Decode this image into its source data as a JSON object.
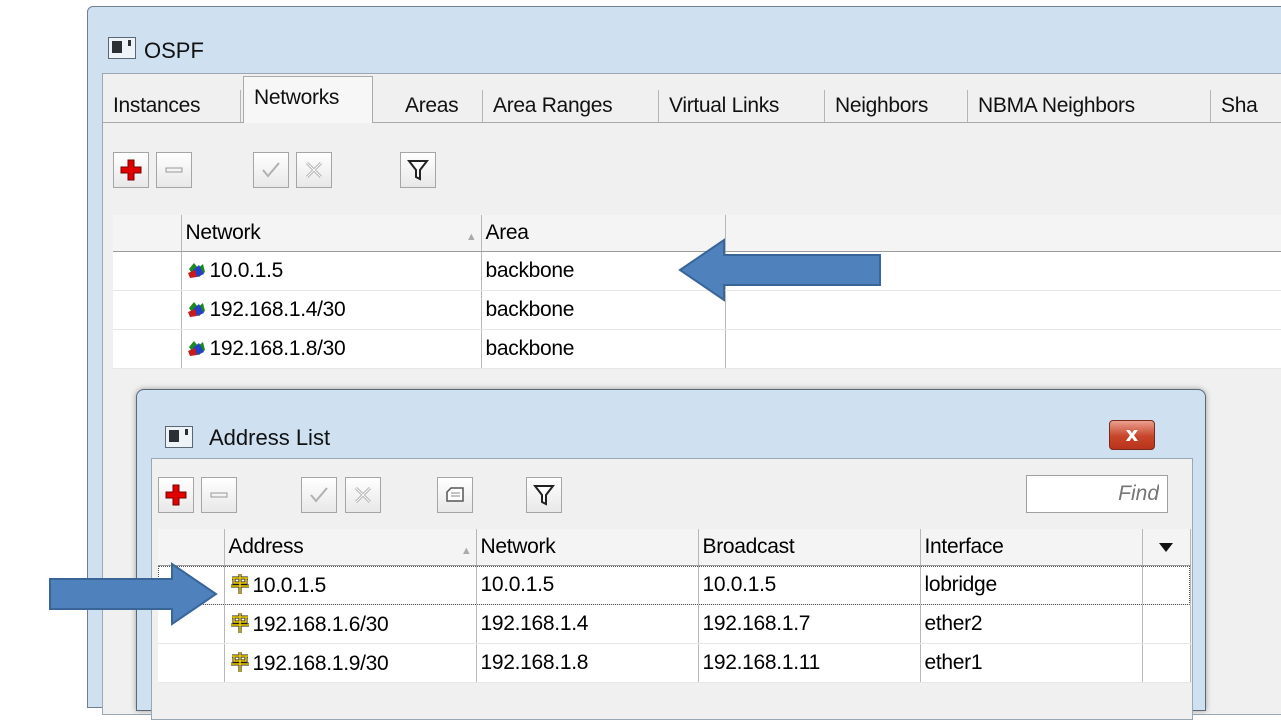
{
  "ospf": {
    "title": "OSPF",
    "tabs": [
      {
        "label": "Instances"
      },
      {
        "label": "Networks"
      },
      {
        "label": "Areas"
      },
      {
        "label": "Area Ranges"
      },
      {
        "label": "Virtual Links"
      },
      {
        "label": "Neighbors"
      },
      {
        "label": "NBMA Neighbors"
      },
      {
        "label": "Sha"
      }
    ],
    "active_tab": "Networks",
    "columns": {
      "network": "Network",
      "area": "Area"
    },
    "rows": [
      {
        "network": "10.0.1.5",
        "area": "backbone"
      },
      {
        "network": "192.168.1.4/30",
        "area": "backbone"
      },
      {
        "network": "192.168.1.8/30",
        "area": "backbone"
      }
    ]
  },
  "address_list": {
    "title": "Address List",
    "close_label": "x",
    "find_placeholder": "Find",
    "columns": {
      "address": "Address",
      "network": "Network",
      "broadcast": "Broadcast",
      "interface": "Interface"
    },
    "rows": [
      {
        "address": "10.0.1.5",
        "network": "10.0.1.5",
        "broadcast": "10.0.1.5",
        "interface": "lobridge"
      },
      {
        "address": "192.168.1.6/30",
        "network": "192.168.1.4",
        "broadcast": "192.168.1.7",
        "interface": "ether2"
      },
      {
        "address": "192.168.1.9/30",
        "network": "192.168.1.8",
        "broadcast": "192.168.1.11",
        "interface": "ether1"
      }
    ]
  },
  "colors": {
    "arrow": "#4f81bd",
    "add_icon": "#e00000",
    "window_frame": "#cfe0f1"
  }
}
